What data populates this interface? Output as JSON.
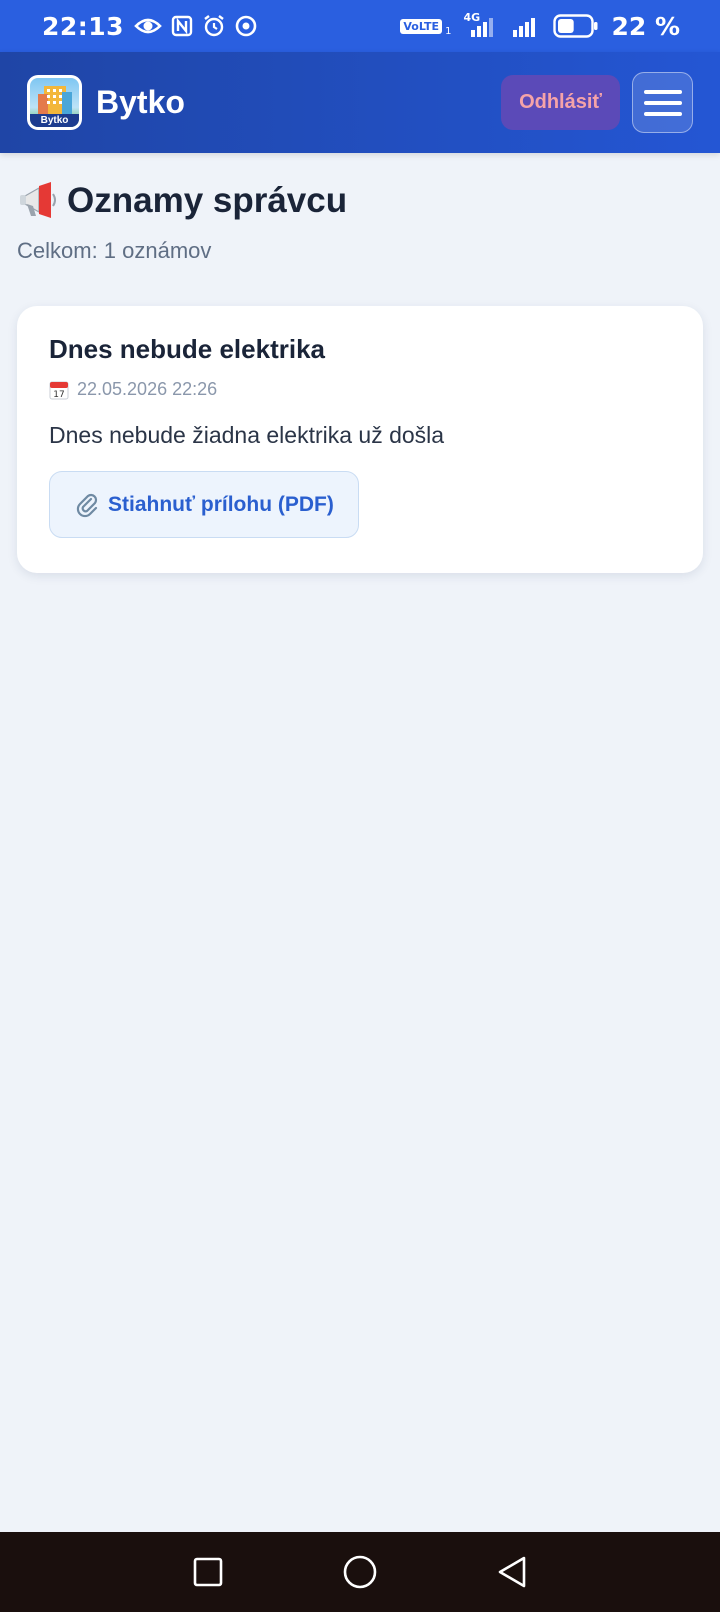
{
  "status_bar": {
    "time": "22:13",
    "network_label": "VoLTE",
    "sim_number": "1",
    "network_type": "4G",
    "battery_percent": "22 %",
    "battery_level": 0.22
  },
  "header": {
    "app_name": "Bytko",
    "logo_text": "Bytko",
    "logout_label": "Odhlásiť",
    "menu_icon": "hamburger-icon"
  },
  "page": {
    "title_icon": "megaphone-icon",
    "title": "Oznamy správcu",
    "count_text": "Celkom: 1 oznámov"
  },
  "announcements": [
    {
      "title": "Dnes nebude elektrika",
      "date_icon": "calendar-icon",
      "date": "22.05.2026 22:26",
      "body": "Dnes nebude žiadna elektrika už došla",
      "attachment_icon": "paperclip-icon",
      "attachment_label": "Stiahnuť prílohu (PDF)"
    }
  ],
  "colors": {
    "status_bar": "#2a5fe0",
    "header_start": "#1f45a6",
    "header_end": "#2456d4",
    "background": "#eff3f9",
    "logout_bg": "#5b4ab8",
    "logout_text": "#f5a3a8",
    "link": "#2a5fcf",
    "nav_bar": "#1a0f0d"
  }
}
